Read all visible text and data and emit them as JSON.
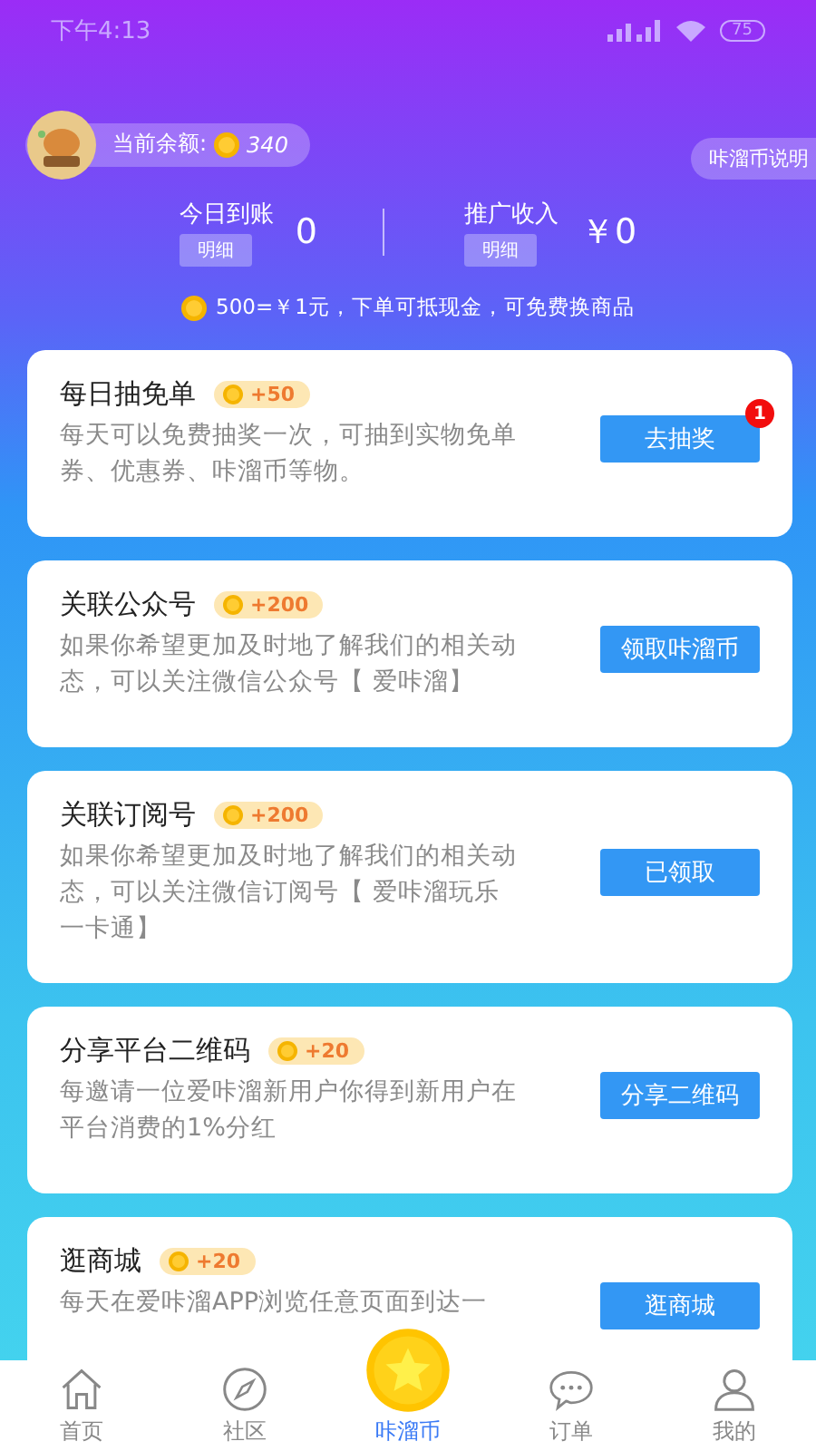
{
  "status_bar": {
    "time": "下午4:13",
    "battery": "75"
  },
  "balance": {
    "label": "当前余额:",
    "amount": "340"
  },
  "explain_button": "咔溜币说明",
  "stats": [
    {
      "label": "今日到账",
      "detail": "明细",
      "value": "0"
    },
    {
      "label": "推广收入",
      "detail": "明细",
      "value": "￥0"
    }
  ],
  "exchange_note": "500=￥1元，下单可抵现金，可免费换商品",
  "tasks": [
    {
      "title": "每日抽免单",
      "reward": "+50",
      "description": "每天可以免费抽奖一次，可抽到实物免单券、优惠券、咔溜币等物。",
      "button": "去抽奖",
      "badge": "1"
    },
    {
      "title": "关联公众号",
      "reward": "+200",
      "description": "如果你希望更加及时地了解我们的相关动态，可以关注微信公众号【 爱咔溜】",
      "button": "领取咔溜币"
    },
    {
      "title": "关联订阅号",
      "reward": "+200",
      "description": "如果你希望更加及时地了解我们的相关动态，可以关注微信订阅号【 爱咔溜玩乐一卡通】",
      "button": "已领取"
    },
    {
      "title": "分享平台二维码",
      "reward": "+20",
      "description": "每邀请一位爱咔溜新用户你得到新用户在平台消费的1%分红",
      "button": "分享二维码"
    },
    {
      "title": "逛商城",
      "reward": "+20",
      "description": "每天在爱咔溜APP浏览任意页面到达一",
      "button": "逛商城"
    }
  ],
  "tab_bar": [
    {
      "label": "首页",
      "kind": "home",
      "selected": false
    },
    {
      "label": "社区",
      "kind": "compass",
      "selected": false
    },
    {
      "label": "咔溜币",
      "kind": "coin",
      "selected": true
    },
    {
      "label": "订单",
      "kind": "chat",
      "selected": false
    },
    {
      "label": "我的",
      "kind": "person",
      "selected": false
    }
  ]
}
